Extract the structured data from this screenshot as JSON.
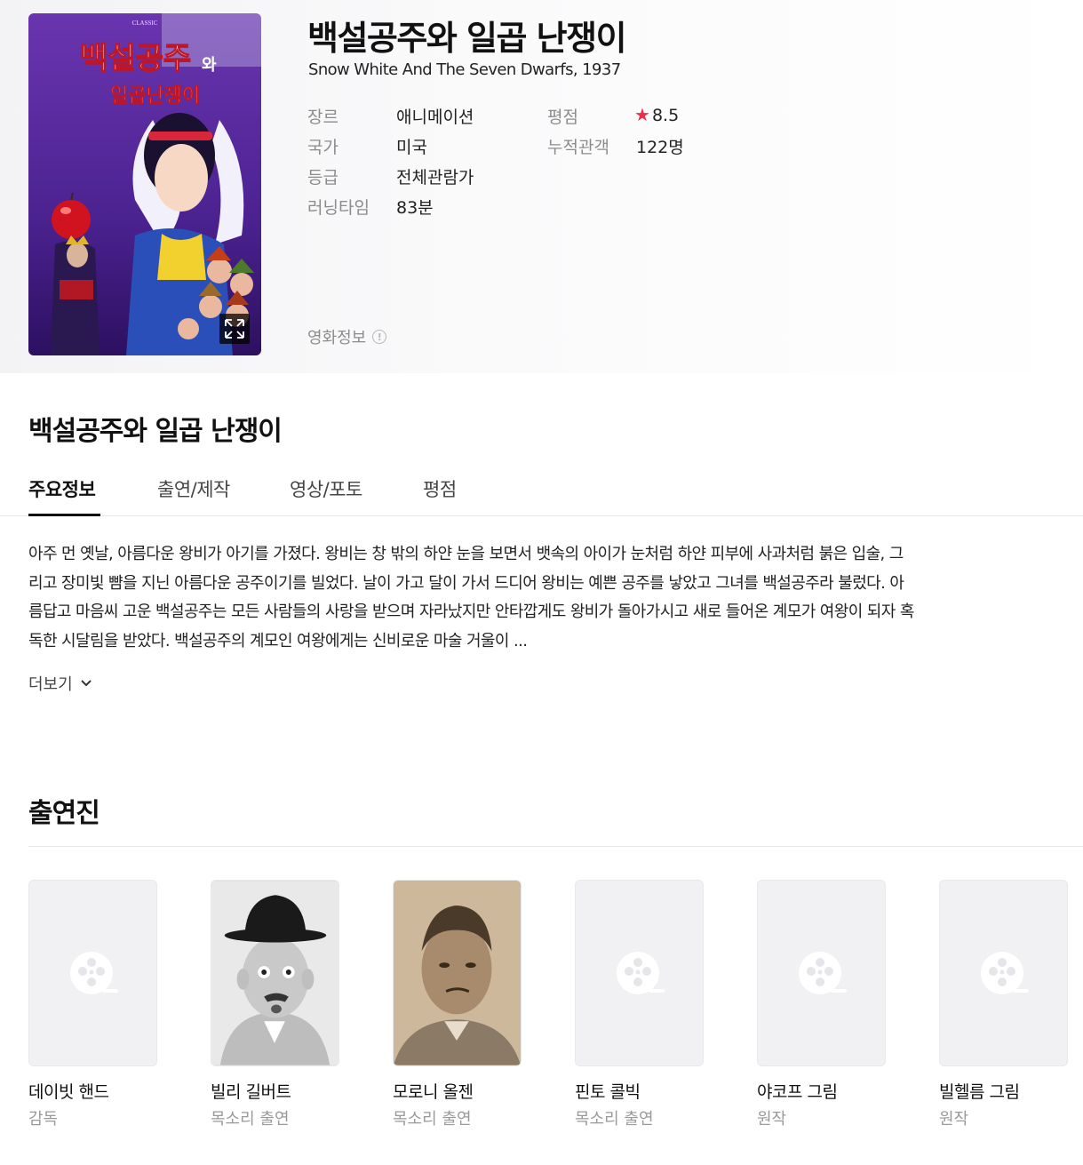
{
  "movie": {
    "title": "백설공주와 일곱 난쟁이",
    "subtitle": "Snow White And The Seven Dwarfs, 1937",
    "poster_lettering": {
      "small": "CLASSIC",
      "line1": "백설공주",
      "line1_suffix": "와",
      "line2": "일곱난쟁이"
    },
    "info": {
      "genre_label": "장르",
      "genre": "애니메이션",
      "country_label": "국가",
      "country": "미국",
      "rating_label": "등급",
      "rating": "전체관람가",
      "runtime_label": "러닝타임",
      "runtime": "83분",
      "score_label": "평점",
      "score": "8.5",
      "audience_label": "누적관객",
      "audience": "122명"
    },
    "info_link": "영화정보",
    "info_link_icon": "!"
  },
  "section_title": "백설공주와 일곱 난쟁이",
  "tabs": [
    {
      "label": "주요정보",
      "active": true
    },
    {
      "label": "출연/제작",
      "active": false
    },
    {
      "label": "영상/포토",
      "active": false
    },
    {
      "label": "평점",
      "active": false
    }
  ],
  "synopsis": "아주 먼 옛날, 아름다운 왕비가 아기를 가졌다. 왕비는 창 밖의 하얀 눈을 보면서 뱃속의 아이가 눈처럼 하얀 피부에 사과처럼 붉은 입술, 그리고 장미빛 뺨을 지닌 아름다운 공주이기를 빌었다. 날이 가고 달이 가서 드디어 왕비는 예쁜 공주를 낳았고 그녀를 백설공주라 불렀다. 아름답고 마음씨 고운 백설공주는 모든 사람들의 사랑을 받으며 자라났지만 안타깝게도 왕비가 돌아가시고 새로 들어온 계모가 여왕이 되자 혹독한 시달림을 받았다. 백설공주의 계모인 여왕에게는 신비로운 마술 거울이 ...",
  "more_label": "더보기",
  "cast_title": "출연진",
  "cast": [
    {
      "name": "데이빗 핸드",
      "role": "감독",
      "photo": "placeholder"
    },
    {
      "name": "빌리 길버트",
      "role": "목소리 출연",
      "photo": "portrait-bowler"
    },
    {
      "name": "모로니 올젠",
      "role": "목소리 출연",
      "photo": "portrait-sepia"
    },
    {
      "name": "핀토 콜빅",
      "role": "목소리 출연",
      "photo": "placeholder"
    },
    {
      "name": "야코프 그림",
      "role": "원작",
      "photo": "placeholder"
    },
    {
      "name": "빌헬름 그림",
      "role": "원작",
      "photo": "placeholder"
    }
  ],
  "colors": {
    "star": "#ee2d4b",
    "label": "#8c8c8c",
    "poster_bg": "#5a2a9a"
  }
}
